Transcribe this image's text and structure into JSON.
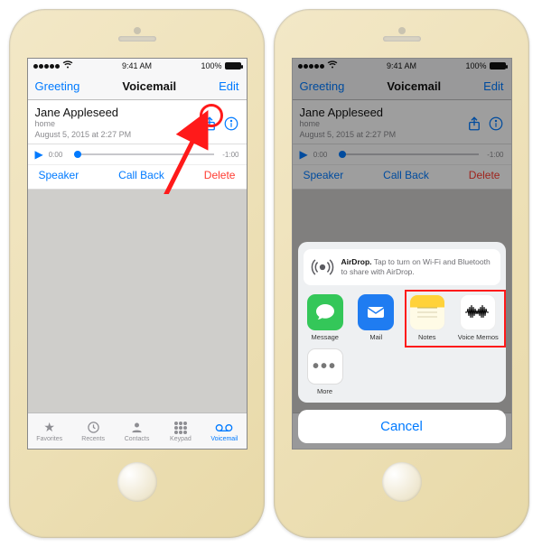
{
  "status": {
    "carrier_signal": 5,
    "time": "9:41 AM",
    "battery_pct": "100%"
  },
  "nav": {
    "left": "Greeting",
    "title": "Voicemail",
    "right": "Edit"
  },
  "voicemail": {
    "caller": "Jane Appleseed",
    "source": "home",
    "timestamp": "August 5, 2015 at 2:27 PM",
    "elapsed": "0:00",
    "remaining": "-1:00"
  },
  "actions": {
    "speaker": "Speaker",
    "callback": "Call Back",
    "delete": "Delete"
  },
  "tabs": {
    "favorites": "Favorites",
    "recents": "Recents",
    "contacts": "Contacts",
    "keypad": "Keypad",
    "voicemail": "Voicemail"
  },
  "sharesheet": {
    "airdrop_bold": "AirDrop.",
    "airdrop_text": "Tap to turn on Wi-Fi and Bluetooth to share with AirDrop.",
    "apps": {
      "message": "Message",
      "mail": "Mail",
      "notes": "Notes",
      "voice_memos": "Voice Memos"
    },
    "more": "More",
    "cancel": "Cancel"
  },
  "annotation": {
    "color": "#ff1a1a"
  }
}
